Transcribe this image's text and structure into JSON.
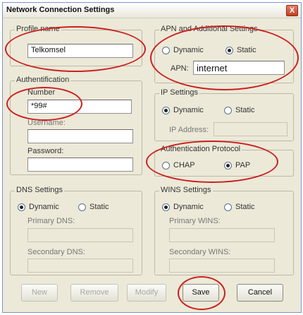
{
  "window": {
    "title": "Network Connection Settings",
    "close_glyph": "X"
  },
  "profile": {
    "legend": "Profile name",
    "value": "Telkomsel"
  },
  "apn": {
    "legend": "APN and Additional Settings",
    "dynamic_label": "Dynamic",
    "static_label": "Static",
    "apn_label": "APN:",
    "apn_value": "internet",
    "selected": "Static"
  },
  "auth": {
    "legend": "Authentification",
    "number_label": "Number",
    "number_value": "*99#",
    "username_label": "Username:",
    "username_value": "",
    "password_label": "Password:",
    "password_value": ""
  },
  "ip": {
    "legend": "IP Settings",
    "dynamic_label": "Dynamic",
    "static_label": "Static",
    "ip_label": "IP Address:",
    "selected": "Dynamic"
  },
  "auth_protocol": {
    "legend": "Authentication Protocol",
    "chap_label": "CHAP",
    "pap_label": "PAP",
    "selected": "PAP"
  },
  "dns": {
    "legend": "DNS Settings",
    "dynamic_label": "Dynamic",
    "static_label": "Static",
    "primary_label": "Primary DNS:",
    "secondary_label": "Secondary DNS:",
    "selected": "Dynamic"
  },
  "wins": {
    "legend": "WINS Settings",
    "dynamic_label": "Dynamic",
    "static_label": "Static",
    "primary_label": "Primary WINS:",
    "secondary_label": "Secondary  WINS:",
    "selected": "Dynamic"
  },
  "buttons": {
    "new": "New",
    "remove": "Remove",
    "modify": "Modify",
    "save": "Save",
    "cancel": "Cancel"
  },
  "colors": {
    "annotation": "#cc1f1f",
    "window_bg": "#ece9d8"
  }
}
